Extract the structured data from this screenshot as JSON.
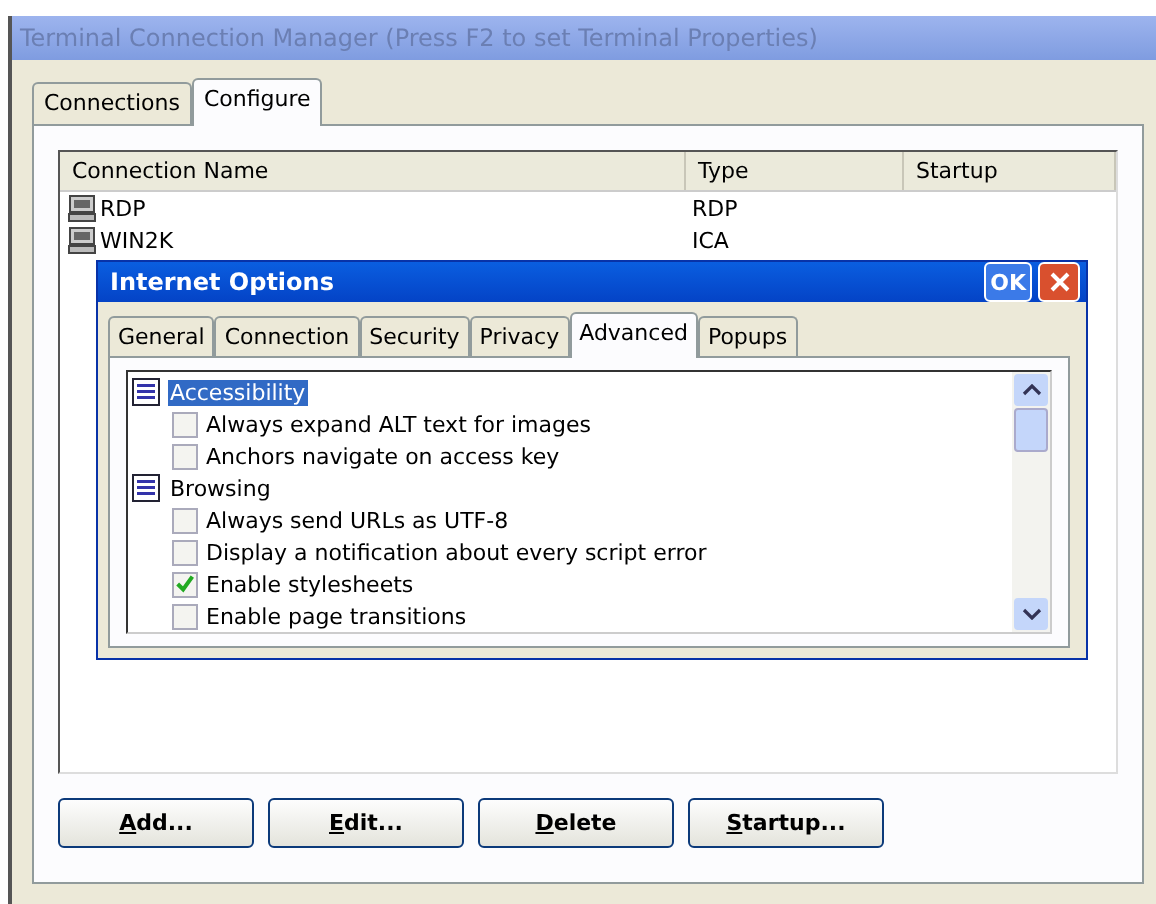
{
  "window": {
    "title": "Terminal Connection Manager (Press F2 to set Terminal Properties)",
    "active": false
  },
  "tabs": [
    {
      "label": "Connections",
      "selected": false
    },
    {
      "label": "Configure",
      "selected": true
    }
  ],
  "table": {
    "columns": [
      "Connection Name",
      "Type",
      "Startup"
    ],
    "rows": [
      {
        "name": "RDP",
        "type": "RDP",
        "startup": "",
        "selected": false
      },
      {
        "name": "WIN2K",
        "type": "ICA",
        "startup": "",
        "selected": false
      }
    ]
  },
  "dialog": {
    "title": "Internet Options",
    "ok": "OK",
    "tabs": [
      {
        "label": "General",
        "selected": false
      },
      {
        "label": "Connection",
        "selected": false
      },
      {
        "label": "Security",
        "selected": false
      },
      {
        "label": "Privacy",
        "selected": false
      },
      {
        "label": "Advanced",
        "selected": true
      },
      {
        "label": "Popups",
        "selected": false
      }
    ],
    "settings": [
      {
        "label": "Accessibility",
        "selected": true,
        "children": [
          {
            "label": "Always expand ALT text for images",
            "checked": false
          },
          {
            "label": "Anchors navigate on access key",
            "checked": false
          }
        ]
      },
      {
        "label": "Browsing",
        "selected": false,
        "children": [
          {
            "label": "Always send URLs as UTF-8",
            "checked": false
          },
          {
            "label": "Display a notification about every script error",
            "checked": false
          },
          {
            "label": "Enable stylesheets",
            "checked": true
          },
          {
            "label": "Enable page transitions",
            "checked": false
          }
        ]
      }
    ]
  },
  "buttons": [
    "Add...",
    "Edit...",
    "Delete",
    "Startup..."
  ]
}
